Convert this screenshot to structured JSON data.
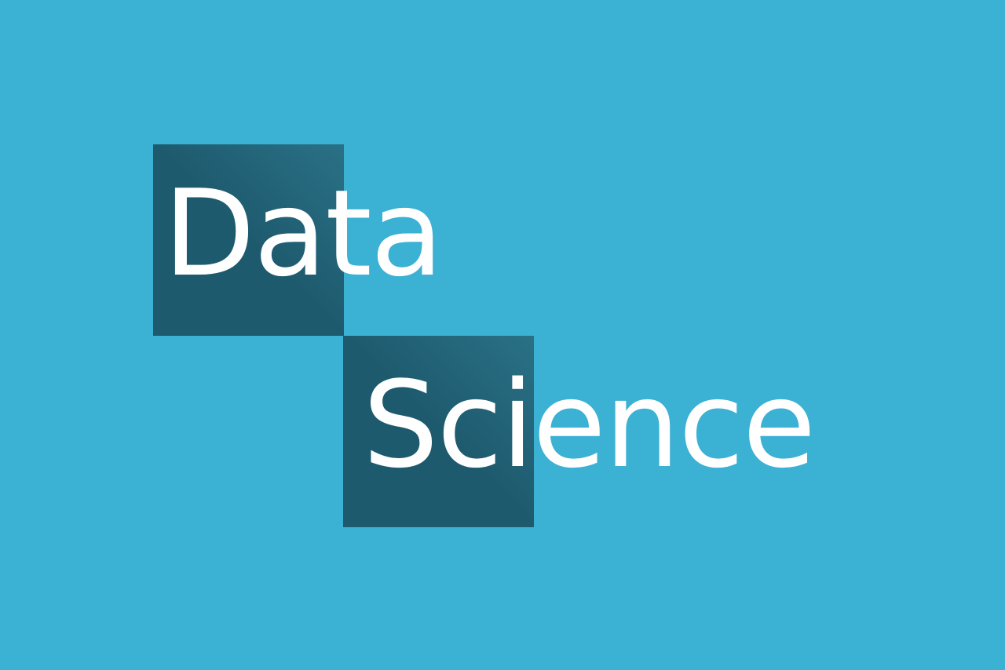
{
  "logo": {
    "line_1": "Data",
    "line_2": "Science"
  },
  "colors": {
    "background": "#3bb1d3",
    "tile_dark": "#1e5a6e",
    "tile_light": "#2a7186",
    "text": "#ffffff"
  }
}
